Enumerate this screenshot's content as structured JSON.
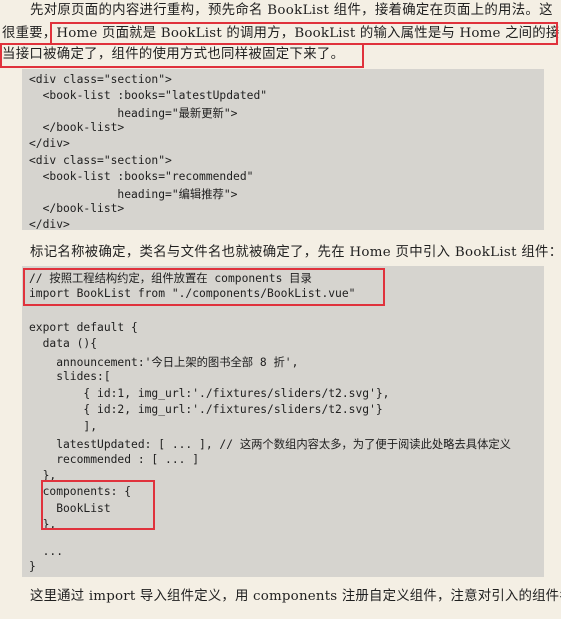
{
  "paragraph1": {
    "line1": "先对原页面的内容进行重构，预先命名 BookList 组件，接着确定在页面上的用法。这",
    "line2": "很重要，Home 页面就是 BookList 的调用方，BookList 的输入属性是与 Home 之间的接口，",
    "line3": "当接口被确定了，组件的使用方式也同样被固定下来了。"
  },
  "code1": {
    "lines": [
      "<div class=\"section\">",
      "  <book-list :books=\"latestUpdated\"",
      "             heading=\"最新更新\">",
      "  </book-list>",
      "</div>",
      "<div class=\"section\">",
      "  <book-list :books=\"recommended\"",
      "             heading=\"编辑推荐\">",
      "  </book-list>",
      "</div>"
    ]
  },
  "paragraph2": "标记名称被确定，类名与文件名也就被确定了，先在 Home 页中引入 BookList 组件：",
  "code2": {
    "lines": [
      "// 按照工程结构约定，组件放置在 components 目录",
      "import BookList from \"./components/BookList.vue\"",
      "",
      "export default {",
      "  data (){",
      "    announcement:'今日上架的图书全部 8 折',",
      "    slides:[",
      "        { id:1, img_url:'./fixtures/sliders/t2.svg'},",
      "        { id:2, img_url:'./fixtures/sliders/t2.svg'}",
      "        ],",
      "    latestUpdated: [ ... ], // 这两个数组内容太多，为了便于阅读此处略去具体定义",
      "    recommended : [ ... ]",
      "  },",
      "  components: {",
      "    BookList",
      "  },",
      "",
      "  ...",
      "}"
    ]
  },
  "paragraph3": "这里通过 import 导入组件定义，用 components 注册自定义组件，注意对引入的组件名",
  "colors": {
    "page_background": "#f4efe4",
    "code_background": "#d6d4cf",
    "highlight_border": "#e0323c"
  }
}
